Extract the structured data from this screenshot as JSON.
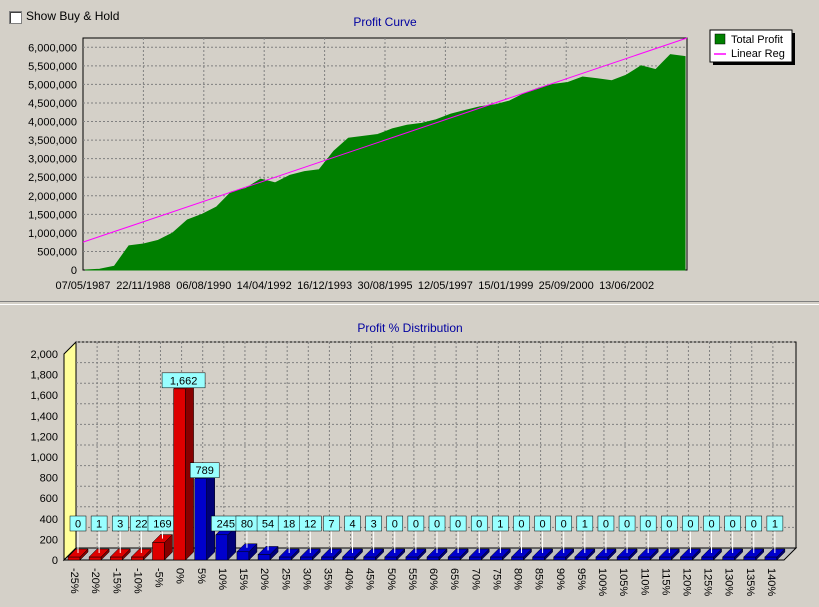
{
  "toolbar": {
    "show_buy_hold_label": "Show Buy & Hold",
    "show_buy_hold_checked": false
  },
  "colors": {
    "background": "#d4d0c8",
    "profit_area": "#008000",
    "linear_reg": "#ff00ff",
    "positive_bar": "#0000cc",
    "negative_bar": "#dd0000",
    "label_box": "#99ffff",
    "wall": "#ffff99"
  },
  "chart_data": [
    {
      "type": "area",
      "title": "Profit Curve",
      "xlabel": "",
      "ylabel": "",
      "x_tick_labels": [
        "07/05/1987",
        "22/11/1988",
        "06/08/1990",
        "14/04/1992",
        "16/12/1993",
        "30/08/1995",
        "12/05/1997",
        "15/01/1999",
        "25/09/2000",
        "13/06/2002"
      ],
      "y_tick_labels": [
        "0",
        "500,000",
        "1,000,000",
        "1,500,000",
        "2,000,000",
        "2,500,000",
        "3,000,000",
        "3,500,000",
        "4,000,000",
        "4,500,000",
        "5,000,000",
        "5,500,000",
        "6,000,000"
      ],
      "ylim": [
        0,
        6250000
      ],
      "grid": true,
      "legend_position": "top-right",
      "legend": [
        "Total Profit",
        "Linear Reg"
      ],
      "series": [
        {
          "name": "Total Profit",
          "type": "area",
          "x": [
            "07/05/1987",
            "05/1987",
            "09/1987",
            "10/1987",
            "03/1988",
            "08/1988",
            "01/1989",
            "06/1989",
            "11/1989",
            "04/1990",
            "08/1990",
            "12/1990",
            "05/1991",
            "09/1991",
            "02/1992",
            "07/1992",
            "12/1992",
            "05/1993",
            "09/1993",
            "02/1994",
            "07/1994",
            "12/1994",
            "05/1995",
            "10/1995",
            "03/1996",
            "08/1996",
            "01/1997",
            "06/1997",
            "11/1997",
            "04/1998",
            "09/1998",
            "02/1999",
            "07/1999",
            "12/1999",
            "05/2000",
            "10/2000",
            "03/2001",
            "08/2001",
            "01/2002",
            "06/2002",
            "11/2002",
            "04/2003"
          ],
          "values": [
            0,
            20000,
            100000,
            650000,
            700000,
            800000,
            1000000,
            1350000,
            1500000,
            1700000,
            2100000,
            2200000,
            2450000,
            2350000,
            2550000,
            2650000,
            2700000,
            3200000,
            3550000,
            3600000,
            3650000,
            3800000,
            3900000,
            3950000,
            4050000,
            4200000,
            4300000,
            4400000,
            4450000,
            4550000,
            4750000,
            4900000,
            5000000,
            5050000,
            5200000,
            5150000,
            5100000,
            5250000,
            5500000,
            5400000,
            5800000,
            5750000
          ]
        },
        {
          "name": "Linear Reg",
          "type": "line",
          "x": [
            "07/05/1987",
            "04/2003"
          ],
          "values": [
            750000,
            6250000
          ]
        }
      ]
    },
    {
      "type": "bar",
      "title": "Profit % Distribution",
      "xlabel": "",
      "ylabel": "",
      "categories": [
        "-25%",
        "-20%",
        "-15%",
        "-10%",
        "-5%",
        "0%",
        "5%",
        "10%",
        "15%",
        "20%",
        "25%",
        "30%",
        "35%",
        "40%",
        "45%",
        "50%",
        "55%",
        "60%",
        "65%",
        "70%",
        "75%",
        "80%",
        "85%",
        "90%",
        "95%",
        "100%",
        "105%",
        "110%",
        "115%",
        "120%",
        "125%",
        "130%",
        "135%",
        "140%"
      ],
      "values": [
        0,
        1,
        3,
        22,
        169,
        1662,
        789,
        245,
        80,
        54,
        18,
        12,
        7,
        4,
        3,
        0,
        0,
        0,
        0,
        0,
        1,
        0,
        0,
        0,
        1,
        0,
        0,
        0,
        0,
        0,
        0,
        0,
        0,
        1
      ],
      "y_tick_labels": [
        "0",
        "200",
        "400",
        "600",
        "800",
        "1,000",
        "1,200",
        "1,400",
        "1,600",
        "1,800",
        "2,000"
      ],
      "ylim": [
        0,
        2000
      ],
      "grid": true,
      "style": "3d"
    }
  ]
}
